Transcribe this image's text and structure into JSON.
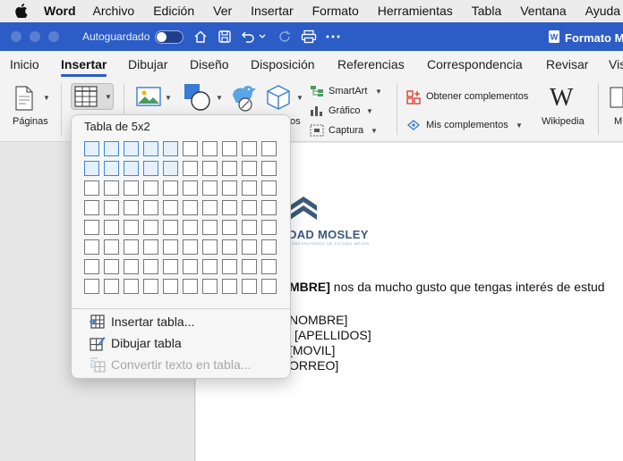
{
  "menubar": {
    "app": "Word",
    "items": [
      "Archivo",
      "Edición",
      "Ver",
      "Insertar",
      "Formato",
      "Herramientas",
      "Tabla",
      "Ventana",
      "Ayuda"
    ]
  },
  "titlebar": {
    "autosave_label": "Autoguardado",
    "doc_title": "Formato M"
  },
  "tabs": [
    "Inicio",
    "Insertar",
    "Dibujar",
    "Diseño",
    "Disposición",
    "Referencias",
    "Correspondencia",
    "Revisar",
    "Vis"
  ],
  "ribbon": {
    "pages_label": "Páginas",
    "smartart_label": "SmartArt",
    "chart_label": "Gráfico",
    "capture_label": "Captura",
    "get_addins_label": "Obtener complementos",
    "my_addins_label": "Mis complementos",
    "wikipedia_label": "Wikipedia",
    "partial_label_left": "os",
    "partial_label_right": "M"
  },
  "table_panel": {
    "title": "Tabla de 5x2",
    "cols": 10,
    "rows": 8,
    "selected_cols": 5,
    "selected_rows": 2,
    "insert_table": "Insertar tabla...",
    "draw_table": "Dibujar tabla",
    "convert_text": "Convertir texto en tabla..."
  },
  "document": {
    "logo_text": "DAD MOSLEY",
    "logo_subtext": "CONSTRUYENDO UN FUTURO MEJOR",
    "line1_bold": "MBRE]",
    "line1_rest": " nos da mucho gusto que tengas interés de estud",
    "field1": "NOMBRE]",
    "field2": "[APELLIDOS]",
    "field3": "[MOVIL]",
    "field4": "ORREO]"
  },
  "colors": {
    "titlebar": "#2c5cc5",
    "accent": "#2c5cc5",
    "grid_selected_border": "#3d86d8",
    "grid_selected_fill": "#e6f1fb"
  }
}
